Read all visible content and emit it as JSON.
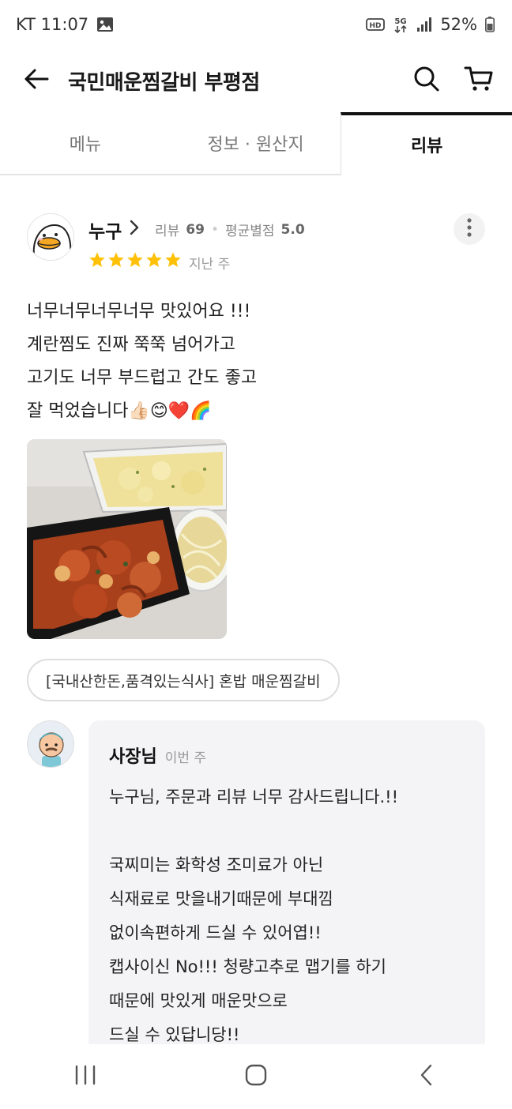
{
  "status_bar": {
    "carrier_time": "KT 11:07",
    "battery": "52%",
    "icons": [
      "gallery-icon",
      "hd-icon",
      "5g-icon",
      "signal-icon",
      "battery-icon"
    ]
  },
  "header": {
    "title": "국민매운찜갈비 부평점",
    "icons": [
      "back-arrow-icon",
      "search-icon",
      "cart-icon"
    ]
  },
  "tabs": [
    {
      "label": "메뉴",
      "active": false
    },
    {
      "label": "정보 · 원산지",
      "active": false
    },
    {
      "label": "리뷰",
      "active": true
    }
  ],
  "review": {
    "reviewer_name": "누구",
    "review_count_label": "리뷰",
    "review_count": "69",
    "avg_rating_label": "평균별점",
    "avg_rating": "5.0",
    "stars": 5,
    "date": "지난 주",
    "text_lines": [
      "너무너무너무너무 맛있어요 !!!",
      "계란찜도 진짜 쭉쭉 넘어가고",
      "고기도 너무 부드럽고 간도 좋고",
      "잘 먹었습니다👍🏻😊❤️🌈"
    ],
    "photo_alt": "review-food-photo",
    "menu_chip": "[국내산한돈,품격있는식사] 혼밥 매운찜갈비"
  },
  "owner_reply": {
    "name": "사장님",
    "date": "이번 주",
    "text_lines": [
      "누구님,  주문과 리뷰 너무 감사드립니다.!!",
      "",
      "국찌미는 화학성 조미료가 아닌",
      "식재료로 맛을내기때문에 부대낌",
      "없이속편하게 드실 수 있어엽!!",
      "캡사이신 No!!! 청량고추로 맵기를 하기",
      "때문에 맛있게 매운맛으로",
      "드실 수 있답니당!!"
    ]
  },
  "colors": {
    "star": "#FFC107",
    "text": "#1a1a1a",
    "muted": "#888888",
    "reply_bg": "#f4f4f6"
  },
  "nav_bar": {
    "icons": [
      "recent-apps-icon",
      "home-icon",
      "back-icon"
    ]
  }
}
